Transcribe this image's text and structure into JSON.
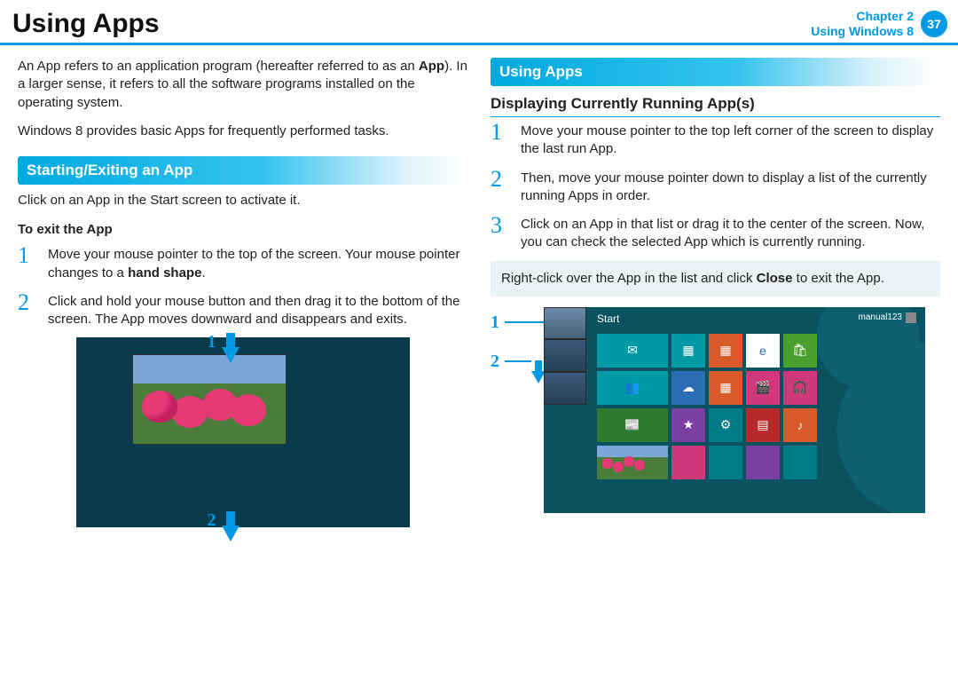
{
  "header": {
    "title": "Using Apps",
    "chapter_label": "Chapter 2",
    "chapter_name": "Using Windows 8",
    "page_number": "37"
  },
  "left": {
    "intro1a": "An App refers to an application program (hereafter referred to as an ",
    "intro1_bold": "App",
    "intro1b": "). In a larger sense, it refers to all the software programs installed on the operating system.",
    "intro2": "Windows 8 provides basic Apps for frequently performed tasks.",
    "section_title": "Starting/Exiting an App",
    "click_line": "Click on an App in the Start screen to activate it.",
    "exit_heading": "To exit the App",
    "steps": [
      {
        "num": "1",
        "a": "Move your mouse pointer to the top of the screen. Your mouse pointer changes to a ",
        "bold": "hand shape",
        "b": "."
      },
      {
        "num": "2",
        "a": "Click and hold your mouse button and then drag it to the bottom of the screen. The App moves downward and disappears and exits.",
        "bold": "",
        "b": ""
      }
    ],
    "callouts": {
      "c1": "1",
      "c2": "2"
    }
  },
  "right": {
    "section_title": "Using Apps",
    "sub_heading": "Displaying Currently Running App(s)",
    "steps": [
      {
        "num": "1",
        "txt": "Move your mouse pointer to the top left corner of the screen to display the last run App."
      },
      {
        "num": "2",
        "txt": "Then, move your mouse pointer down to display a list of the currently running Apps in order."
      },
      {
        "num": "3",
        "txt": "Click on an App in that list or drag it to the center of the screen. Now, you can check the selected App which is currently running."
      }
    ],
    "note_a": "Right-click over the App in the list and click ",
    "note_bold": "Close",
    "note_b": " to exit the App.",
    "callouts": {
      "c1": "1",
      "c2": "2"
    },
    "start_label": "Start",
    "user_label": "manual123",
    "tile_icons": [
      "✉",
      "▦",
      "▦",
      "e",
      "🛍",
      "👥",
      "☁",
      "▦",
      "🎬",
      "🎧",
      "📰",
      "★",
      "⚙",
      "▤",
      "♪"
    ]
  }
}
